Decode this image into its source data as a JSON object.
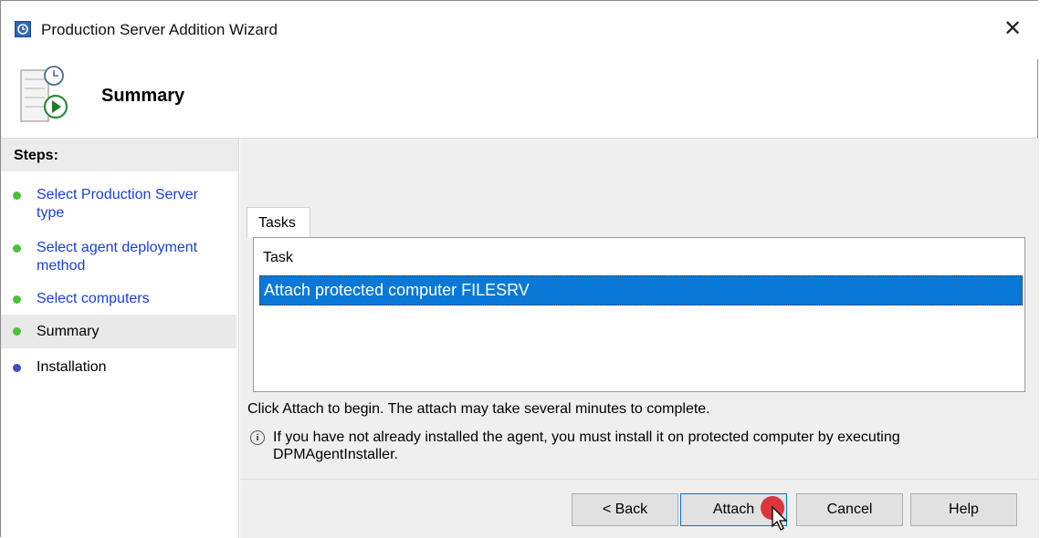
{
  "window": {
    "title": "Production Server Addition Wizard",
    "close_glyph": "✕"
  },
  "header": {
    "title": "Summary",
    "icon": "wizard-summary-icon"
  },
  "steps": {
    "title": "Steps:",
    "items": [
      {
        "label": "Select Production Server type",
        "status": "complete",
        "dot_color": "#4fbf3a"
      },
      {
        "label": "Select agent deployment method",
        "status": "complete",
        "dot_color": "#4fbf3a"
      },
      {
        "label": "Select computers",
        "status": "complete",
        "dot_color": "#4fbf3a"
      },
      {
        "label": "Summary",
        "status": "current",
        "dot_color": "#4fbf3a"
      },
      {
        "label": "Installation",
        "status": "pending",
        "dot_color": "#3e4fc4"
      }
    ]
  },
  "main": {
    "tab_label": "Tasks",
    "column_header": "Task",
    "rows": [
      "Attach protected computer FILESRV"
    ],
    "hint": "Click Attach to begin. The attach may take several minutes to complete.",
    "info_text": "If you have not already installed the agent, you must install it on protected computer by executing DPMAgentInstaller."
  },
  "buttons": {
    "back": "< Back",
    "attach": "Attach",
    "cancel": "Cancel",
    "help": "Help"
  },
  "colors": {
    "selection": "#0a78d7",
    "link": "#1a3fd6",
    "cursor_highlight": "#d9363e"
  }
}
